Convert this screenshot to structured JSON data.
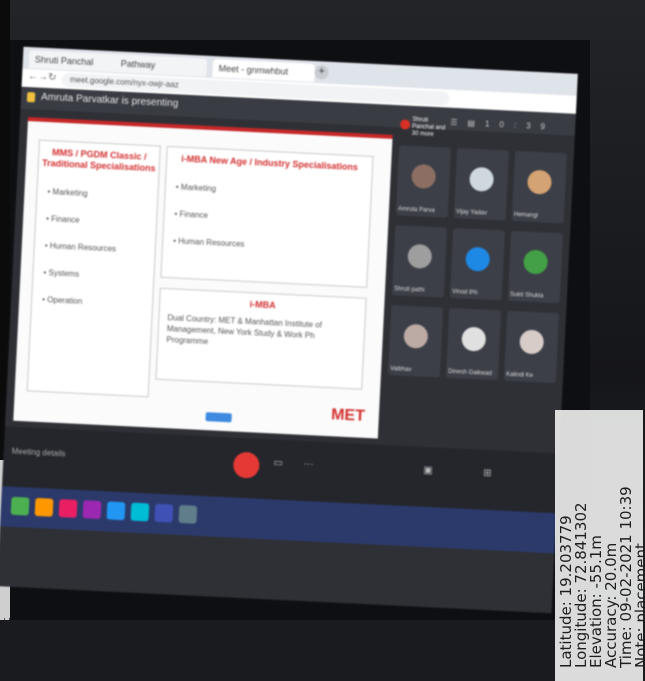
{
  "browser": {
    "tabs": [
      "Shruti Panchal",
      "Pathway",
      "Meet - gnmwhbut"
    ],
    "url": "meet.google.com/nyx-owjr-aaz"
  },
  "meet": {
    "presenting": "Amruta Parvatkar is presenting",
    "badge": "Shruti Panchal and 30 more",
    "time": "10:39",
    "meeting_details": "Meeting details"
  },
  "slide": {
    "box1": {
      "heading": "MMS / PGDM Classic / Traditional Specialisations",
      "items": [
        "Marketing",
        "Finance",
        "Human Resources",
        "Systems",
        "Operation"
      ]
    },
    "box2": {
      "heading": "i-MBA New Age / Industry Specialisations",
      "items": [
        "Marketing",
        "Finance",
        "Human Resources"
      ]
    },
    "box3": {
      "heading": "i-MBA",
      "text": "Dual Country: MET & Manhattan Institute of Management, New York Study & Work Ph Programme"
    },
    "logo": "MET"
  },
  "participants": [
    "Amruta Parva",
    "Vijay Yadav",
    "Hemangi",
    "Shruti pathi",
    "Vinod 8%",
    "Sukti Shukla",
    "Vaibhav",
    "Dinesh Gaikwad",
    "Kalindi Ke"
  ],
  "geotag": {
    "latitude": "Latitude: 19.203779",
    "longitude": "Longitude: 72.841302",
    "elevation": "Elevation: -55.1m",
    "accuracy": "Accuracy: 20.0m",
    "time": "Time: 09-02-2021 10:39",
    "note": "Note: placement"
  },
  "left_stamp": "placement"
}
